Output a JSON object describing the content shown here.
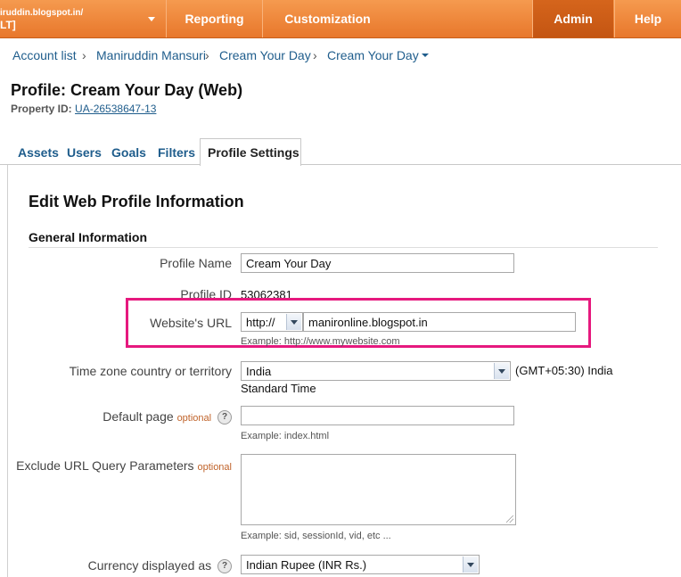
{
  "topbar": {
    "account_line1": "iruddin.blogspot.in/",
    "account_line2": "LT]",
    "nav": [
      "Reporting",
      "Customization",
      "Admin",
      "Help"
    ]
  },
  "breadcrumb": [
    "Account list",
    "Maniruddin Mansuri",
    "Cream Your Day",
    "Cream Your Day"
  ],
  "page": {
    "title": "Profile: Cream Your Day (Web)",
    "property_label": "Property ID:",
    "property_id": "UA-26538647-13"
  },
  "tabs": [
    "Assets",
    "Users",
    "Goals",
    "Filters",
    "Profile Settings"
  ],
  "form": {
    "heading": "Edit Web Profile Information",
    "section": "General Information",
    "profile_name_label": "Profile Name",
    "profile_name_value": "Cream Your Day",
    "profile_id_label": "Profile ID",
    "profile_id_value": "53062381",
    "website_url_label": "Website's URL",
    "protocol_value": "http://",
    "website_url_value": "manironline.blogspot.in",
    "website_url_hint": "Example: http://www.mywebsite.com",
    "timezone_label": "Time zone country or territory",
    "timezone_country": "India",
    "timezone_desc_line1": "(GMT+05:30) India",
    "timezone_desc_line2": "Standard Time",
    "default_page_label": "Default page",
    "optional_text": "optional",
    "help_glyph": "?",
    "default_page_value": "",
    "default_page_hint": "Example: index.html",
    "exclude_label": "Exclude URL Query Parameters",
    "exclude_hint": "Example: sid, sessionId, vid, etc ...",
    "currency_label": "Currency displayed as",
    "currency_value": "Indian Rupee (INR Rs.)"
  },
  "colors": {
    "topbar": "#e8772b",
    "admin_active": "#c45512",
    "link": "#1f5d8c",
    "highlight_border": "#e6197e"
  }
}
